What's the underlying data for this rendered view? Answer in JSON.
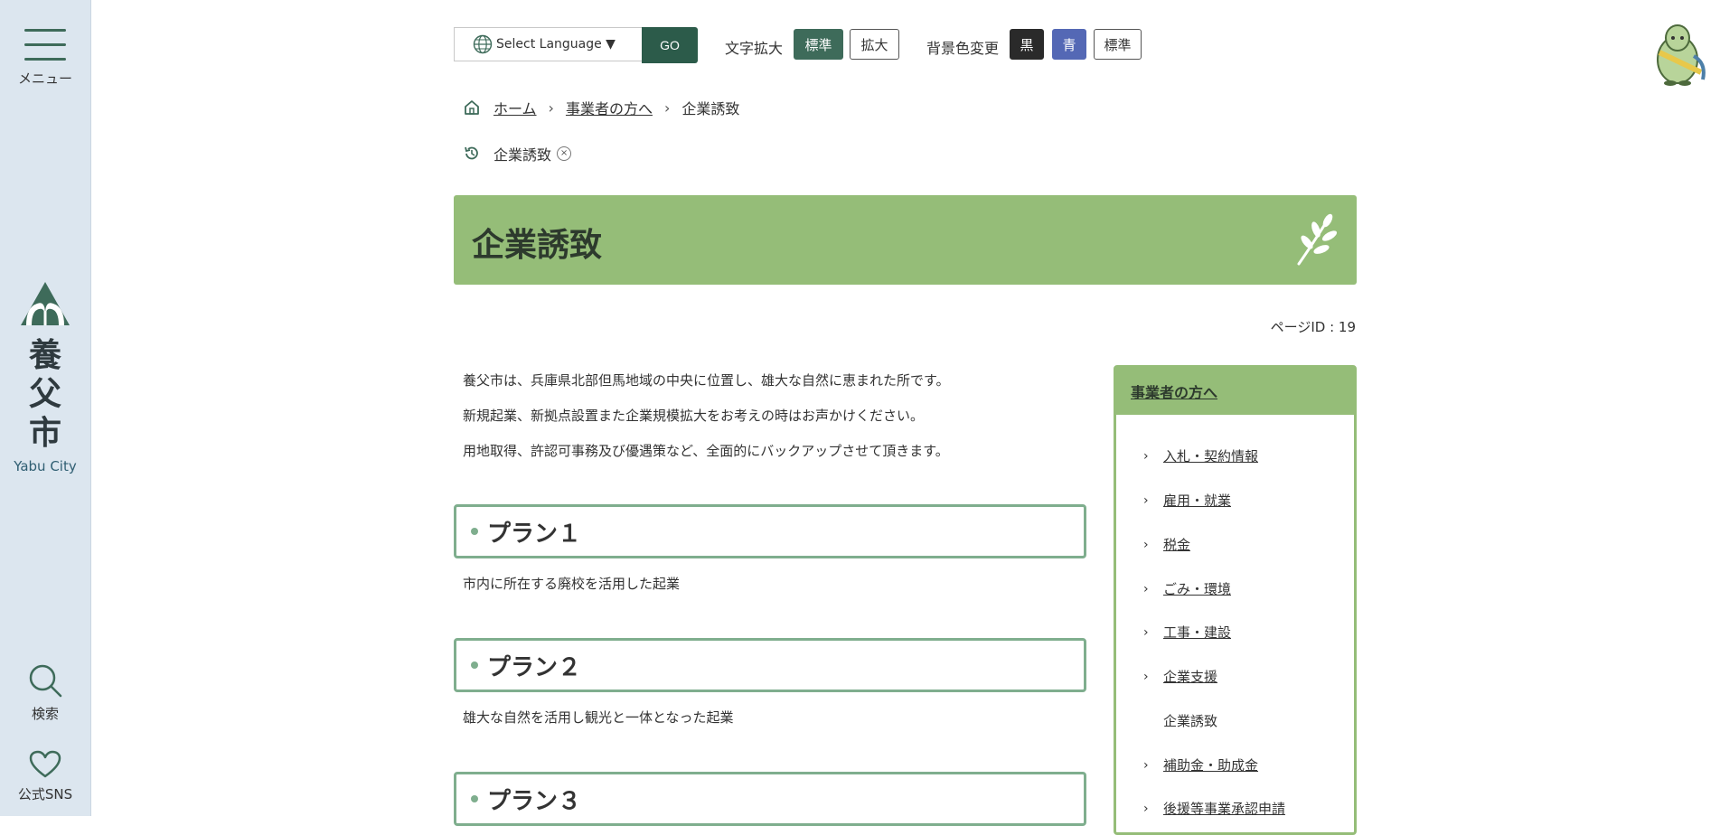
{
  "sidebar": {
    "menu_label": "メニュー",
    "logo_kanji": [
      "養",
      "父",
      "市"
    ],
    "logo_en": "Yabu City",
    "search_label": "検索",
    "sns_label": "公式SNS"
  },
  "tools": {
    "language_select": "Select Language ▼",
    "go_label": "GO",
    "font_size_label": "文字拡大",
    "font_normal": "標準",
    "font_large": "拡大",
    "bg_change_label": "背景色変更",
    "bg_black": "黒",
    "bg_blue": "青",
    "bg_normal": "標準"
  },
  "breadcrumb": {
    "home": "ホーム",
    "parent": "事業者の方へ",
    "current": "企業誘致"
  },
  "history": {
    "item": "企業誘致",
    "close": "×"
  },
  "page": {
    "title": "企業誘致",
    "page_id": "ページID : 19"
  },
  "intro": [
    "養父市は、兵庫県北部但馬地域の中央に位置し、雄大な自然に恵まれた所です。",
    "新規起業、新拠点設置また企業規模拡大をお考えの時はお声かけください。",
    "用地取得、許認可事務及び優遇策など、全面的にバックアップさせて頂きます。"
  ],
  "plans": [
    {
      "title": "プラン１",
      "desc": "市内に所在する廃校を活用した起業"
    },
    {
      "title": "プラン２",
      "desc": "雄大な自然を活用し観光と一体となった起業"
    },
    {
      "title": "プラン３",
      "desc": ""
    }
  ],
  "side_nav": {
    "header": "事業者の方へ",
    "items": [
      {
        "label": "入札・契約情報"
      },
      {
        "label": "雇用・就業"
      },
      {
        "label": "税金"
      },
      {
        "label": "ごみ・環境"
      },
      {
        "label": "工事・建設"
      },
      {
        "label": "企業支援"
      },
      {
        "label": "企業誘致"
      },
      {
        "label": "補助金・助成金"
      },
      {
        "label": "後援等事業承認申請"
      }
    ]
  },
  "colors": {
    "accent_green": "#3e6b5a",
    "banner_green": "#95bd78",
    "plan_border": "#7fae8e",
    "sidebar_bg": "#dce6ef",
    "bg_blue": "#5468b5"
  }
}
